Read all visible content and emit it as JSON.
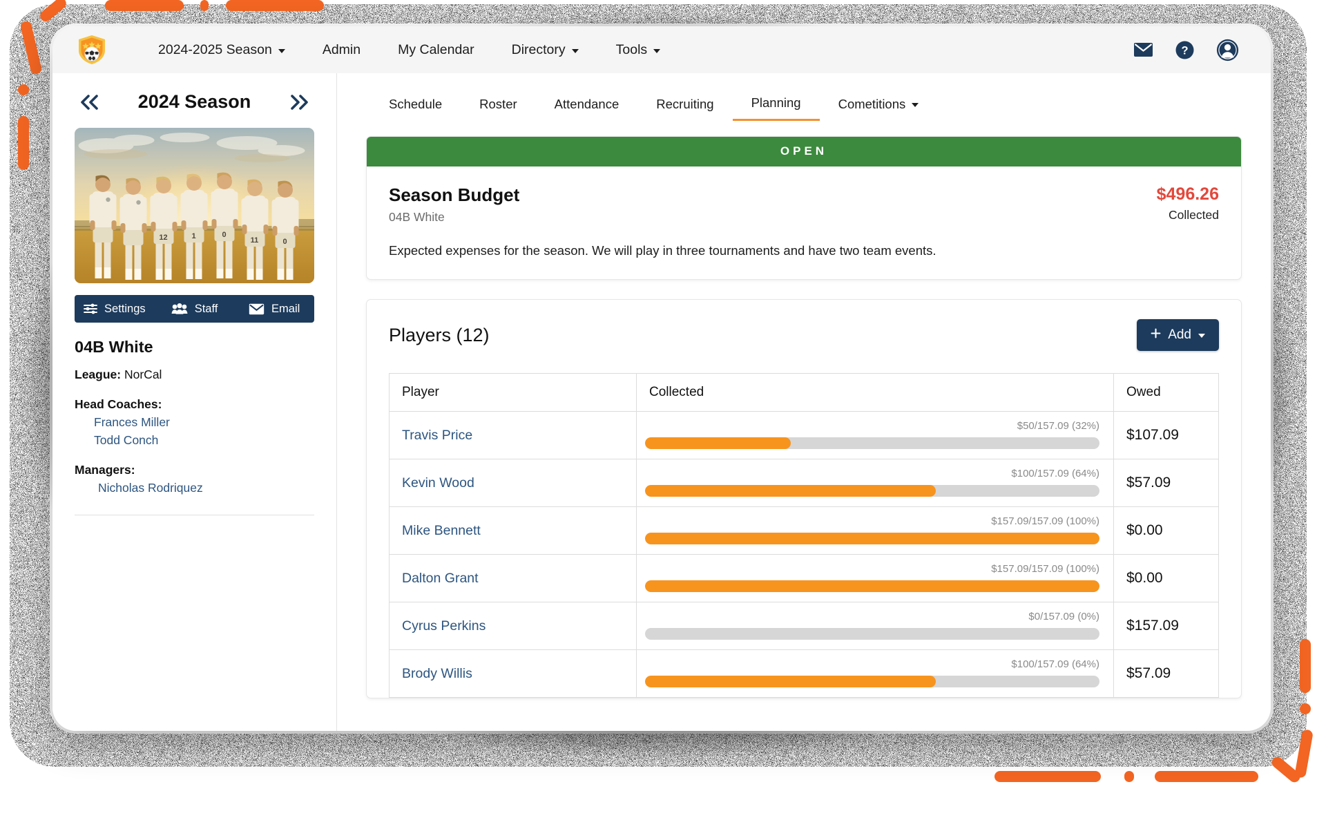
{
  "topnav": {
    "logo_icon": "soccer-shield-logo",
    "items": [
      {
        "label": "2024-2025 Season",
        "has_caret": true
      },
      {
        "label": "Admin",
        "has_caret": false
      },
      {
        "label": "My Calendar",
        "has_caret": false
      },
      {
        "label": "Directory",
        "has_caret": true
      },
      {
        "label": "Tools",
        "has_caret": true
      }
    ],
    "right_icons": [
      "mail-icon",
      "help-icon",
      "user-avatar-icon"
    ]
  },
  "sidebar": {
    "prev_icon": "chevron-double-left-icon",
    "next_icon": "chevron-double-right-icon",
    "season_title": "2024 Season",
    "photo_alt": "team-photo",
    "actions": [
      {
        "label": "Settings",
        "icon": "sliders-icon"
      },
      {
        "label": "Staff",
        "icon": "people-icon"
      },
      {
        "label": "Email",
        "icon": "envelope-icon"
      }
    ],
    "team_name": "04B White",
    "league_label": "League:",
    "league_value": "NorCal",
    "head_coaches_label": "Head Coaches:",
    "head_coaches": [
      "Frances Miller",
      "Todd Conch"
    ],
    "managers_label": "Managers:",
    "managers": [
      "Nicholas Rodriquez"
    ]
  },
  "main": {
    "tabs": [
      {
        "label": "Schedule",
        "active": false,
        "has_caret": false
      },
      {
        "label": "Roster",
        "active": false,
        "has_caret": false
      },
      {
        "label": "Attendance",
        "active": false,
        "has_caret": false
      },
      {
        "label": "Recruiting",
        "active": false,
        "has_caret": false
      },
      {
        "label": "Planning",
        "active": true,
        "has_caret": false
      },
      {
        "label": "Cometitions",
        "active": false,
        "has_caret": true
      }
    ],
    "budget": {
      "status": "OPEN",
      "status_color": "#3c8a3e",
      "title": "Season Budget",
      "subtitle": "04B White",
      "amount": "$496.26",
      "amount_color": "#e2483c",
      "amount_label": "Collected",
      "description": "Expected expenses for the season. We will play in three tournaments and have two team events."
    },
    "players": {
      "title": "Players (12)",
      "add_label": "Add",
      "add_plus_icon": "plus-icon",
      "add_caret_icon": "chevron-down-icon",
      "columns": [
        "Player",
        "Collected",
        "Owed"
      ],
      "rows": [
        {
          "player": "Travis Price",
          "bar_label": "$50/157.09 (32%)",
          "percent": 32,
          "owed": "$107.09"
        },
        {
          "player": "Kevin Wood",
          "bar_label": "$100/157.09 (64%)",
          "percent": 64,
          "owed": "$57.09"
        },
        {
          "player": "Mike Bennett",
          "bar_label": "$157.09/157.09 (100%)",
          "percent": 100,
          "owed": "$0.00"
        },
        {
          "player": "Dalton Grant",
          "bar_label": "$157.09/157.09 (100%)",
          "percent": 100,
          "owed": "$0.00"
        },
        {
          "player": "Cyrus Perkins",
          "bar_label": "$0/157.09 (0%)",
          "percent": 0,
          "owed": "$157.09"
        },
        {
          "player": "Brody Willis",
          "bar_label": "$100/157.09 (64%)",
          "percent": 64,
          "owed": "$57.09"
        }
      ]
    }
  },
  "theme": {
    "accent_orange": "#f7941e",
    "navy": "#1d3b5c",
    "green": "#3c8a3e",
    "red": "#e2483c",
    "link_blue": "#2d5580",
    "decor_orange": "#f26522"
  }
}
